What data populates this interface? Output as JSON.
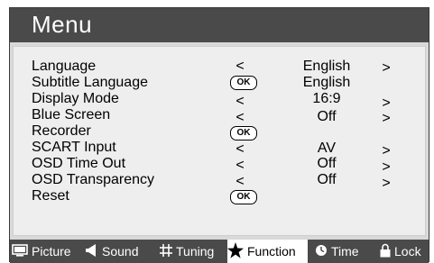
{
  "header": {
    "title": "Menu"
  },
  "menu": {
    "items": [
      {
        "label": "Language",
        "value": "English",
        "left_arrow": "<",
        "right_arrow": ">"
      },
      {
        "label": "Subtitle Language",
        "value": "English",
        "ok": "OK"
      },
      {
        "label": "Display Mode",
        "value": "16:9",
        "left_arrow": "<",
        "right_arrow": ">"
      },
      {
        "label": "Blue Screen",
        "value": "Off",
        "left_arrow": "<",
        "right_arrow": ">"
      },
      {
        "label": "Recorder",
        "ok": "OK"
      },
      {
        "label": "SCART Input",
        "value": "AV",
        "left_arrow": "<",
        "right_arrow": ">"
      },
      {
        "label": "OSD Time Out",
        "value": "Off",
        "left_arrow": "<",
        "right_arrow": ">"
      },
      {
        "label": "OSD Transparency",
        "value": "Off",
        "left_arrow": "<",
        "right_arrow": ">"
      },
      {
        "label": "Reset",
        "ok": "OK"
      }
    ]
  },
  "tabs": [
    {
      "label": "Picture",
      "icon": "monitor-icon"
    },
    {
      "label": "Sound",
      "icon": "speaker-icon"
    },
    {
      "label": "Tuning",
      "icon": "grid-icon"
    },
    {
      "label": "Function",
      "icon": "star-icon",
      "active": true
    },
    {
      "label": "Time",
      "icon": "clock-icon"
    },
    {
      "label": "Lock",
      "icon": "lock-icon"
    }
  ],
  "colors": {
    "header_bg": "#4a4a4a",
    "panel_bg": "#eeeeee",
    "frame_bg": "#d9d9d9",
    "active_tab_bg": "#ffffff"
  }
}
